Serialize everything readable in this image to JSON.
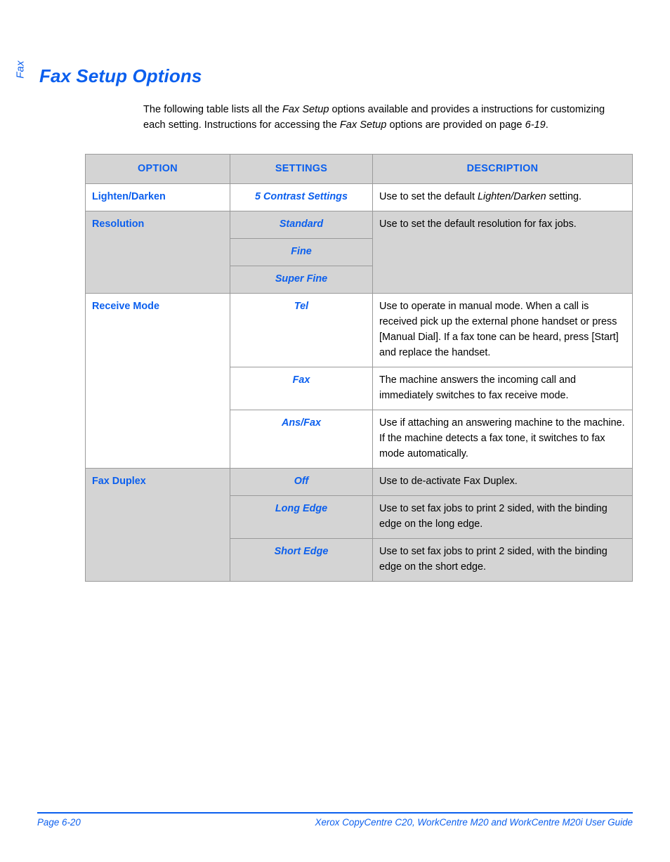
{
  "page": {
    "side_tab_label": "Fax",
    "title": "Fax Setup Options",
    "accent_color": "#0B5FEE",
    "header_fill": "#D4D4D4",
    "border_color": "#9A9A9A"
  },
  "intro": {
    "part1": "The following table lists all the ",
    "em1": "Fax Setup",
    "part2": " options available and provides a instructions for customizing each setting. Instructions for accessing the ",
    "em2": "Fax Setup",
    "part3": " options are provided on page ",
    "em3": "6-19",
    "part4": "."
  },
  "table": {
    "headers": {
      "option": "OPTION",
      "settings": "SETTINGS",
      "description": "DESCRIPTION"
    },
    "rows": [
      {
        "option": "Lighten/Darken",
        "shaded": false,
        "settings": [
          {
            "value": "5 Contrast Settings",
            "desc_before": "Use to set the default ",
            "desc_em": "Lighten/Darken",
            "desc_after": " setting."
          }
        ]
      },
      {
        "option": "Resolution",
        "shaded": true,
        "merged_description": "Use to set the default resolution for fax jobs.",
        "settings": [
          {
            "value": "Standard"
          },
          {
            "value": "Fine"
          },
          {
            "value": "Super Fine"
          }
        ]
      },
      {
        "option": "Receive Mode",
        "shaded": false,
        "settings": [
          {
            "value": "Tel",
            "description": "Use to operate in manual mode. When a call is received pick up the external phone handset or press [Manual Dial]. If a fax tone can be heard, press [Start] and replace the handset."
          },
          {
            "value": "Fax",
            "description": "The machine answers the incoming call and immediately switches to fax receive mode."
          },
          {
            "value": "Ans/Fax",
            "description": "Use if attaching an answering machine to the machine. If the machine detects a fax tone, it switches to fax mode automatically."
          }
        ]
      },
      {
        "option": "Fax Duplex",
        "shaded": true,
        "settings": [
          {
            "value": "Off",
            "description": "Use to de-activate Fax Duplex."
          },
          {
            "value": "Long Edge",
            "description": "Use to set fax jobs to print 2 sided, with the binding edge on the long edge."
          },
          {
            "value": "Short Edge",
            "description": "Use to set fax jobs to print 2 sided, with the binding edge on the short edge."
          }
        ]
      }
    ]
  },
  "footer": {
    "page_label": "Page 6-20",
    "guide_title": "Xerox CopyCentre C20, WorkCentre M20 and WorkCentre M20i User Guide"
  }
}
